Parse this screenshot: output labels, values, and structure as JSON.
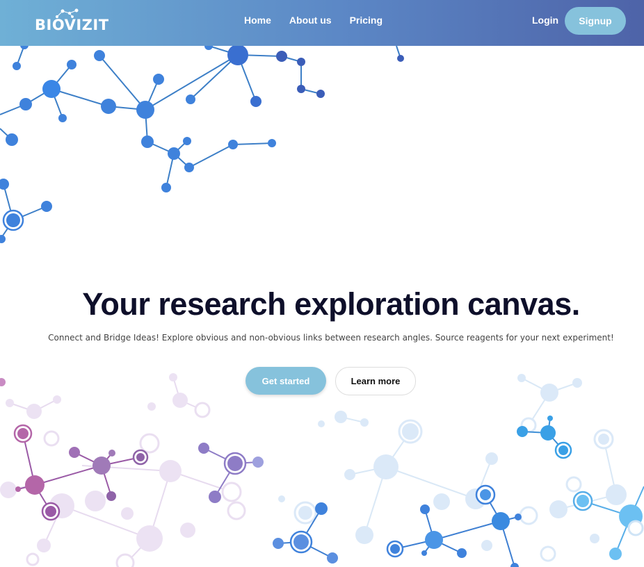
{
  "brand": {
    "logo_text": "BIOVIZIT"
  },
  "nav": {
    "links": [
      {
        "label": "Home"
      },
      {
        "label": "About us"
      },
      {
        "label": "Pricing"
      }
    ],
    "login": "Login",
    "signup": "Signup"
  },
  "hero": {
    "title": "Your research exploration canvas.",
    "subtitle": "Connect and Bridge Ideas! Explore obvious and non-obvious links between research angles. Source reagents for your next experiment!",
    "primary_button": "Get started",
    "secondary_button": "Learn more"
  },
  "colors": {
    "nav_gradient_start": "#6fb0d6",
    "nav_gradient_end": "#4e63a8",
    "button_accent": "#86c2dc",
    "title_color": "#0e0f2a"
  }
}
